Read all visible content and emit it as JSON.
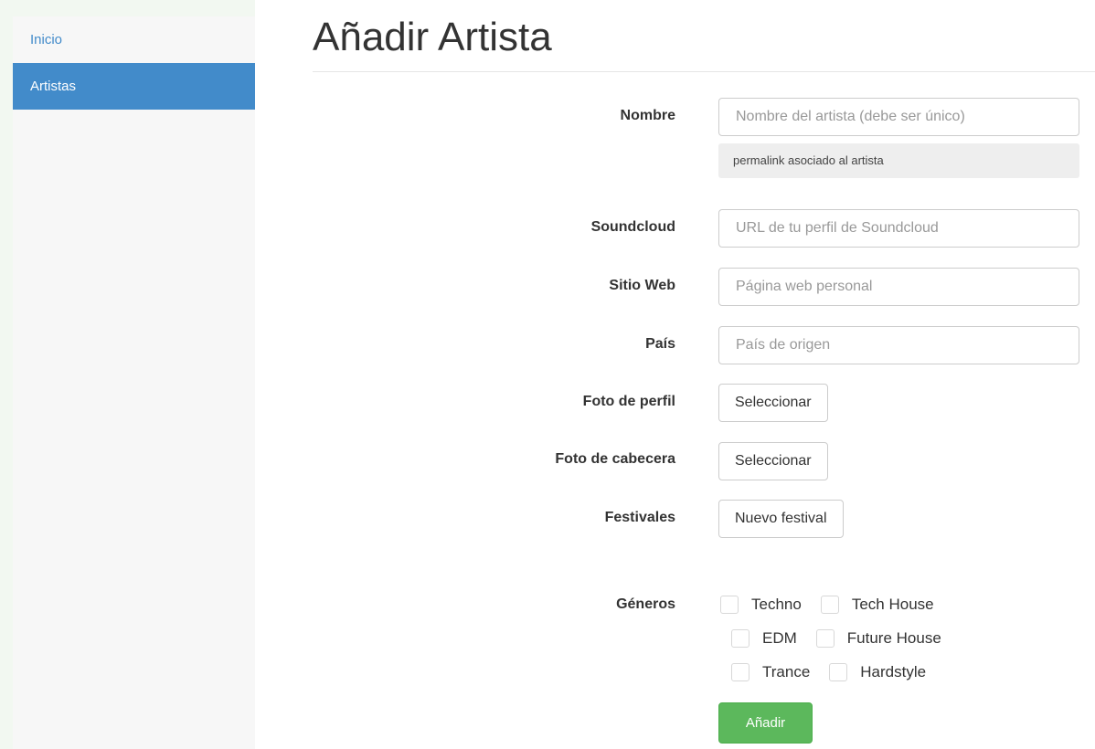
{
  "sidebar": {
    "items": [
      {
        "label": "Inicio"
      },
      {
        "label": "Artistas"
      }
    ]
  },
  "page": {
    "title": "Añadir Artista"
  },
  "form": {
    "nombre": {
      "label": "Nombre",
      "placeholder": "Nombre del artista (debe ser único)"
    },
    "permalink": {
      "text": "permalink asociado al artista"
    },
    "soundcloud": {
      "label": "Soundcloud",
      "placeholder": "URL de tu perfil de Soundcloud"
    },
    "sitio_web": {
      "label": "Sitio Web",
      "placeholder": "Página web personal"
    },
    "pais": {
      "label": "País",
      "placeholder": "País de origen"
    },
    "foto_perfil": {
      "label": "Foto de perfil",
      "button": "Seleccionar"
    },
    "foto_cabecera": {
      "label": "Foto de cabecera",
      "button": "Seleccionar"
    },
    "festivales": {
      "label": "Festivales",
      "button": "Nuevo festival"
    },
    "generos": {
      "label": "Géneros",
      "options": [
        "Techno",
        "Tech House",
        "EDM",
        "Future House",
        "Trance",
        "Hardstyle"
      ]
    },
    "submit": "Añadir"
  },
  "colors": {
    "primary": "#428bca",
    "success": "#5cb85c"
  }
}
